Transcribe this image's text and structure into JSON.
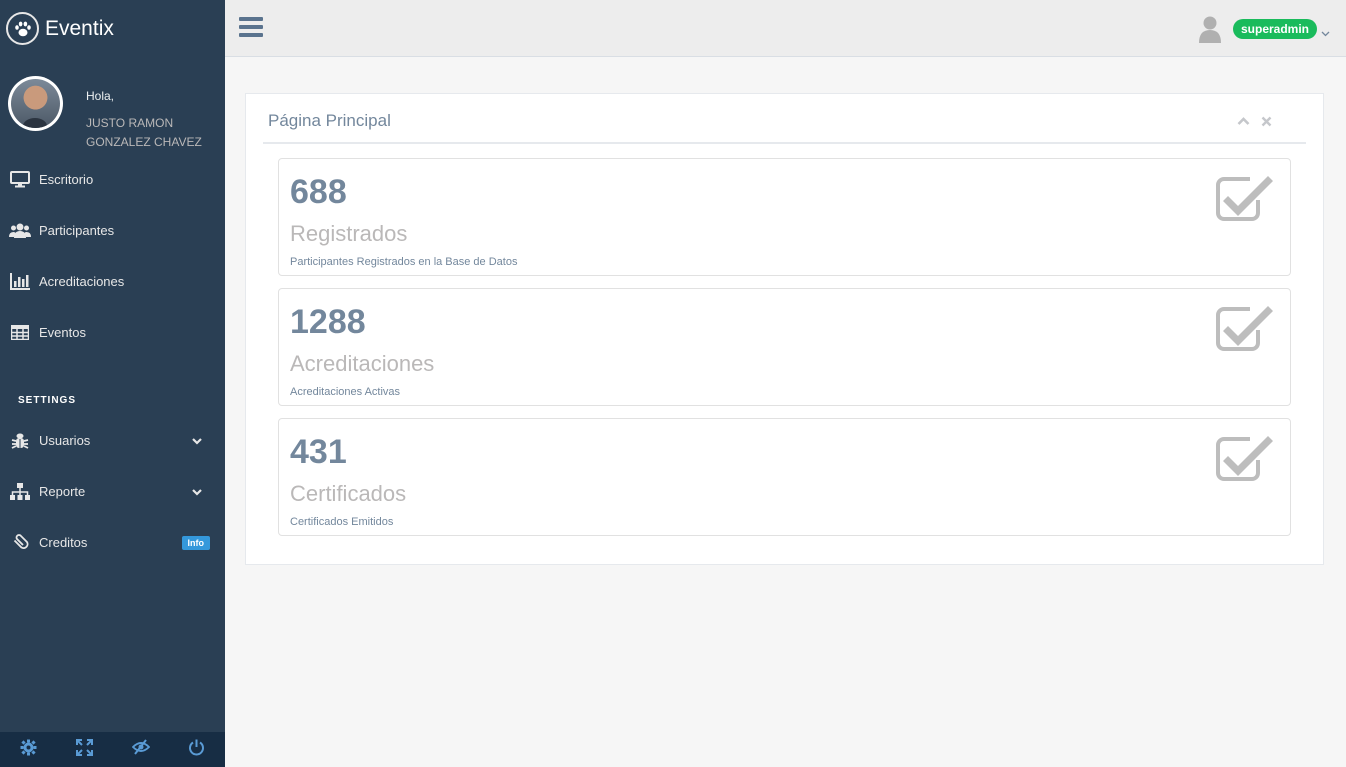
{
  "sidebar": {
    "brand": "Eventix",
    "greeting": "Hola,",
    "user_name": "JUSTO RAMON GONZALEZ CHAVEZ",
    "items": [
      {
        "label": "Escritorio",
        "icon": "desktop-icon"
      },
      {
        "label": "Participantes",
        "icon": "users-icon"
      },
      {
        "label": "Acreditaciones",
        "icon": "bar-chart-icon"
      },
      {
        "label": "Eventos",
        "icon": "table-icon"
      }
    ],
    "section_title": "SETTINGS",
    "settings_items": [
      {
        "label": "Usuarios",
        "icon": "bug-icon"
      },
      {
        "label": "Reporte",
        "icon": "sitemap-icon"
      },
      {
        "label": "Creditos",
        "icon": "paperclip-icon",
        "badge": "Info"
      }
    ],
    "footer": [
      "settings-icon",
      "fullscreen-icon",
      "eye-slash-icon",
      "power-icon"
    ]
  },
  "topnav": {
    "user": "superadmin"
  },
  "panel": {
    "title": "Página Principal",
    "stats": [
      {
        "count": "688",
        "name": "Registrados",
        "desc": "Participantes Registrados en la Base de Datos"
      },
      {
        "count": "1288",
        "name": "Acreditaciones",
        "desc": "Acreditaciones Activas"
      },
      {
        "count": "431",
        "name": "Certificados",
        "desc": "Certificados Emitidos"
      }
    ]
  },
  "colors": {
    "sidebar_bg": "#2a3f54",
    "accent_green": "#1abb5c",
    "text_muted": "#73879c"
  }
}
